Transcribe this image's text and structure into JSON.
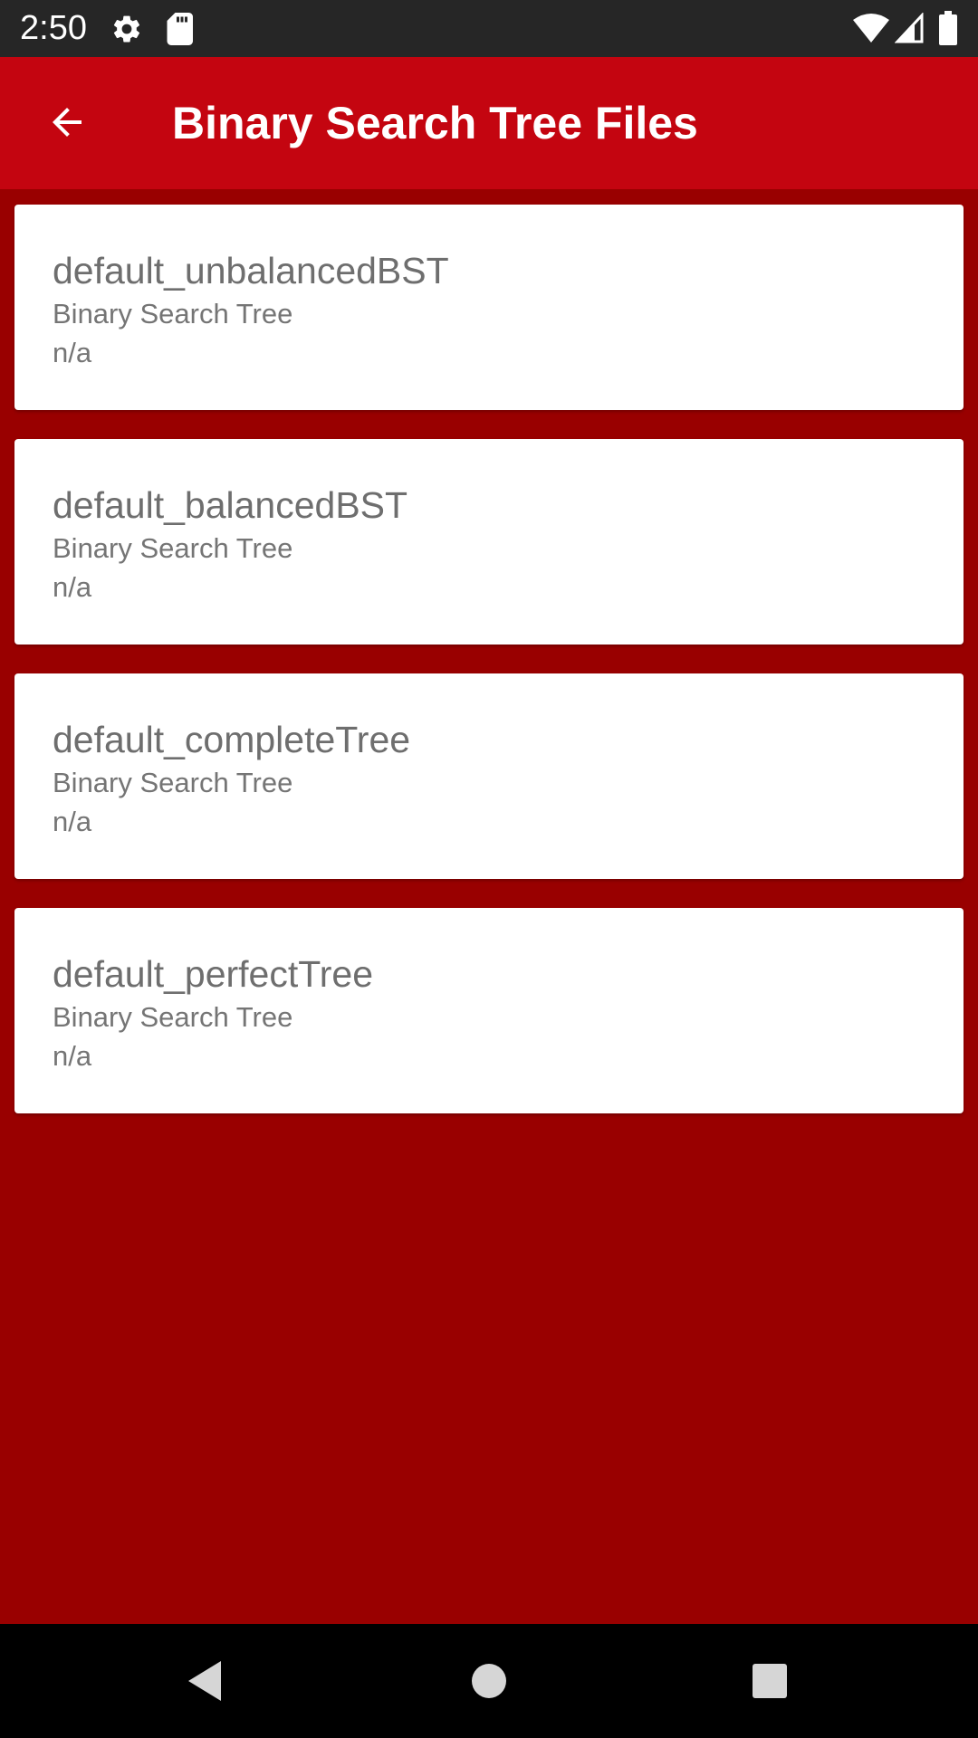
{
  "status_bar": {
    "time": "2:50",
    "icons": [
      "settings-gear-icon",
      "sd-card-icon",
      "wifi-icon",
      "cell-signal-icon",
      "battery-icon"
    ]
  },
  "app_bar": {
    "title": "Binary Search Tree Files",
    "back_icon": "arrow-back-icon",
    "color": "#c40510"
  },
  "background_color": "#990000",
  "files": [
    {
      "name": "default_unbalancedBST",
      "type": "Binary Search Tree",
      "date": "n/a"
    },
    {
      "name": "default_balancedBST",
      "type": "Binary Search Tree",
      "date": "n/a"
    },
    {
      "name": "default_completeTree",
      "type": "Binary Search Tree",
      "date": "n/a"
    },
    {
      "name": "default_perfectTree",
      "type": "Binary Search Tree",
      "date": "n/a"
    }
  ],
  "nav_bar": {
    "buttons": [
      "back-triangle-icon",
      "home-circle-icon",
      "recents-square-icon"
    ]
  }
}
